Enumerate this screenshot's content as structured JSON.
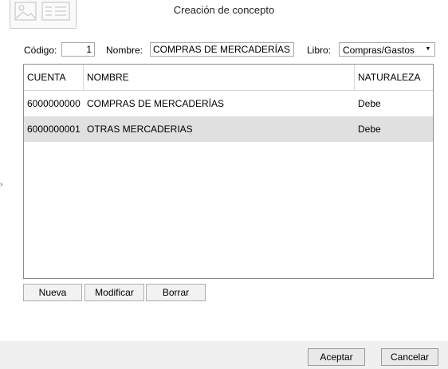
{
  "dialog": {
    "title": "Creación de concepto"
  },
  "form": {
    "codigo_label": "Código:",
    "codigo_value": "1",
    "nombre_label": "Nombre:",
    "nombre_value": "COMPRAS DE MERCADERÍAS",
    "libro_label": "Libro:",
    "libro_value": "Compras/Gastos"
  },
  "table": {
    "columns": [
      "CUENTA",
      "NOMBRE",
      "NATURALEZA"
    ],
    "rows": [
      {
        "cuenta": "6000000000",
        "nombre": "COMPRAS DE MERCADERÍAS",
        "naturaleza": "Debe",
        "selected": false
      },
      {
        "cuenta": "6000000001",
        "nombre": "OTRAS MERCADERIAS",
        "naturaleza": "Debe",
        "selected": true
      }
    ]
  },
  "actions": {
    "nueva": "Nueva",
    "modificar": "Modificar",
    "borrar": "Borrar"
  },
  "footer": {
    "aceptar": "Aceptar",
    "cancelar": "Cancelar"
  },
  "colors": {
    "selected_row": "#e0e0e0",
    "footer_bg": "#f0f0f0"
  }
}
